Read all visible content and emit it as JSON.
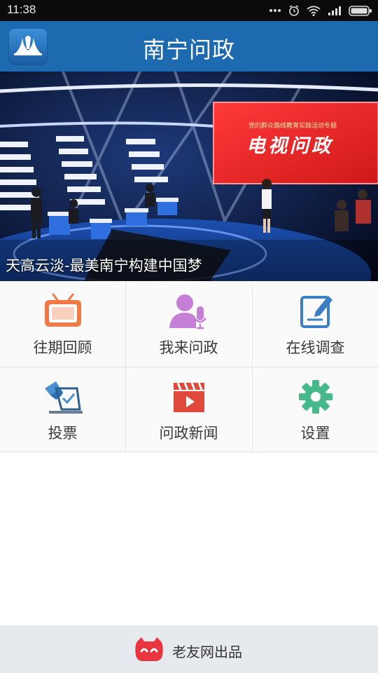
{
  "status_bar": {
    "time": "11:38"
  },
  "app_bar": {
    "title": "南宁问政",
    "logo_icon": "city-logo-icon"
  },
  "banner": {
    "caption": "天高云淡-最美南宁构建中国梦",
    "screen_text": "电视问政",
    "screen_subtitle": "党的群众路线教育实践活动专题"
  },
  "menu": [
    {
      "label": "往期回顾",
      "icon": "tv-icon",
      "color": "#f07a46"
    },
    {
      "label": "我来问政",
      "icon": "user-microphone-icon",
      "color": "#c57fd6"
    },
    {
      "label": "在线调查",
      "icon": "edit-icon",
      "color": "#3d7fc4"
    },
    {
      "label": "投票",
      "icon": "vote-icon",
      "color": "#4a8fcf"
    },
    {
      "label": "问政新闻",
      "icon": "video-clapper-icon",
      "color": "#e04a3c"
    },
    {
      "label": "设置",
      "icon": "gear-icon",
      "color": "#45b98a"
    }
  ],
  "footer": {
    "text": "老友网出品",
    "brand_icon": "laoyou-logo-icon"
  }
}
